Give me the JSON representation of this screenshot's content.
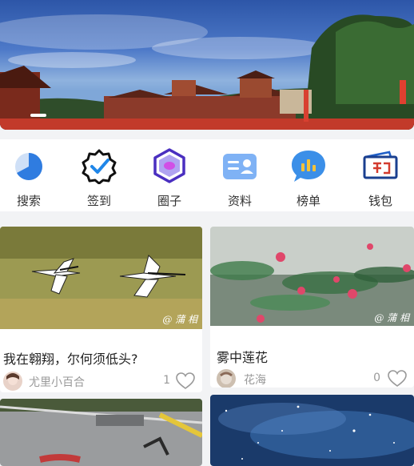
{
  "banner": {
    "image": "temple-landscape-photo",
    "page_indicator": "1"
  },
  "menu": [
    {
      "label": "搜索",
      "icon": "pie-chart-icon",
      "color": "#2f7ce0"
    },
    {
      "label": "签到",
      "icon": "badge-check-icon",
      "color": "#1f86e8"
    },
    {
      "label": "圈子",
      "icon": "hexagon-icon",
      "color": "#5b3fd6"
    },
    {
      "label": "资料",
      "icon": "profile-card-icon",
      "color": "#4a8ff0"
    },
    {
      "label": "榜单",
      "icon": "chat-bubble-chart-icon",
      "color": "#3b8fe8"
    },
    {
      "label": "钱包",
      "icon": "wallet-icon",
      "color": "#1f5fc8"
    }
  ],
  "feed": [
    {
      "title": "我在翱翔，尔何须低头?",
      "user": "尤里小百合",
      "likes": "1",
      "watermark": "@ 蒲 相",
      "image": "cranes-flying-photo"
    },
    {
      "title": "雾中莲花",
      "user": "花海",
      "likes": "0",
      "watermark": "@ 蒲 相",
      "image": "lotus-in-mist-photo"
    },
    {
      "title": "",
      "user": "",
      "likes": "",
      "watermark": "",
      "image": "bicycle-road-photo"
    },
    {
      "title": "",
      "user": "",
      "likes": "",
      "watermark": "",
      "image": "starry-sky-photo"
    }
  ]
}
